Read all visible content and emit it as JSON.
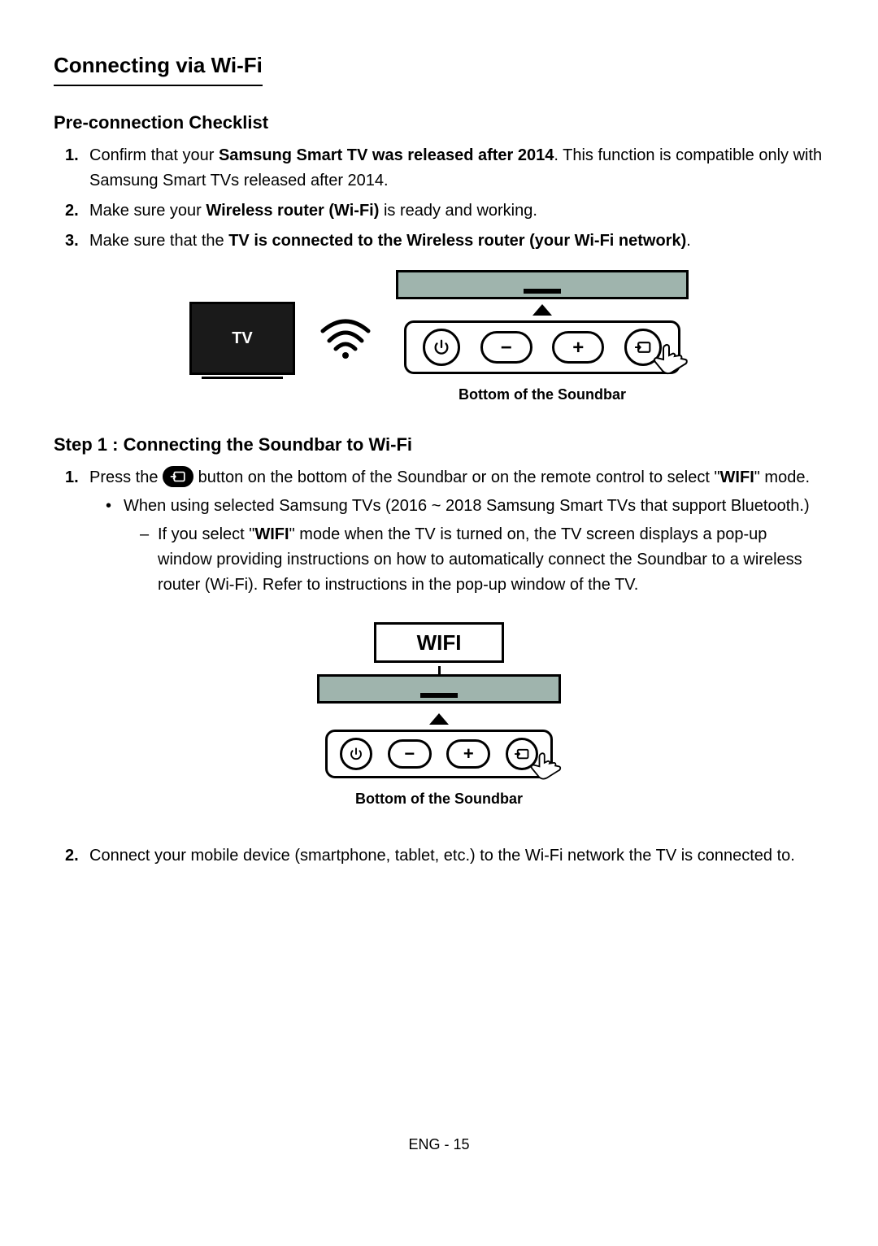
{
  "section_title": "Connecting via Wi-Fi",
  "pre": {
    "heading": "Pre-connection Checklist",
    "items": [
      {
        "num": "1.",
        "pre": "Confirm that your ",
        "bold": "Samsung Smart TV was released after 2014",
        "post": ". This function is compatible only with Samsung Smart TVs released after 2014."
      },
      {
        "num": "2.",
        "pre": "Make sure your ",
        "bold": "Wireless router (Wi-Fi)",
        "post": " is ready and working."
      },
      {
        "num": "3.",
        "pre": "Make sure that the ",
        "bold": "TV is connected to the Wireless router (your Wi-Fi network)",
        "post": "."
      }
    ]
  },
  "diagram1": {
    "tv_label": "TV",
    "caption": "Bottom of the Soundbar"
  },
  "step1": {
    "heading": "Step 1 : Connecting the Soundbar to Wi-Fi",
    "item1": {
      "num": "1.",
      "pre": "Press the ",
      "mid": " button on the bottom of the Soundbar or on the remote control to select \"",
      "bold_after": "WIFI",
      "end": "\" mode."
    },
    "bullet1": "When using selected Samsung TVs (2016 ~ 2018 Samsung Smart TVs that support Bluetooth.)",
    "dash1": {
      "pre": "If you select \"",
      "bold": "WIFI",
      "post": "\" mode when the TV is turned on, the TV screen displays a pop-up window providing instructions on how to automatically connect the Soundbar to a wireless router (Wi-Fi). Refer to instructions in the pop-up window of the TV."
    },
    "item2": {
      "num": "2.",
      "text": "Connect your mobile device (smartphone, tablet, etc.) to the Wi-Fi network the TV is connected to."
    }
  },
  "diagram2": {
    "wifi_label": "WIFI",
    "caption": "Bottom of the Soundbar"
  },
  "footer": "ENG - 15"
}
